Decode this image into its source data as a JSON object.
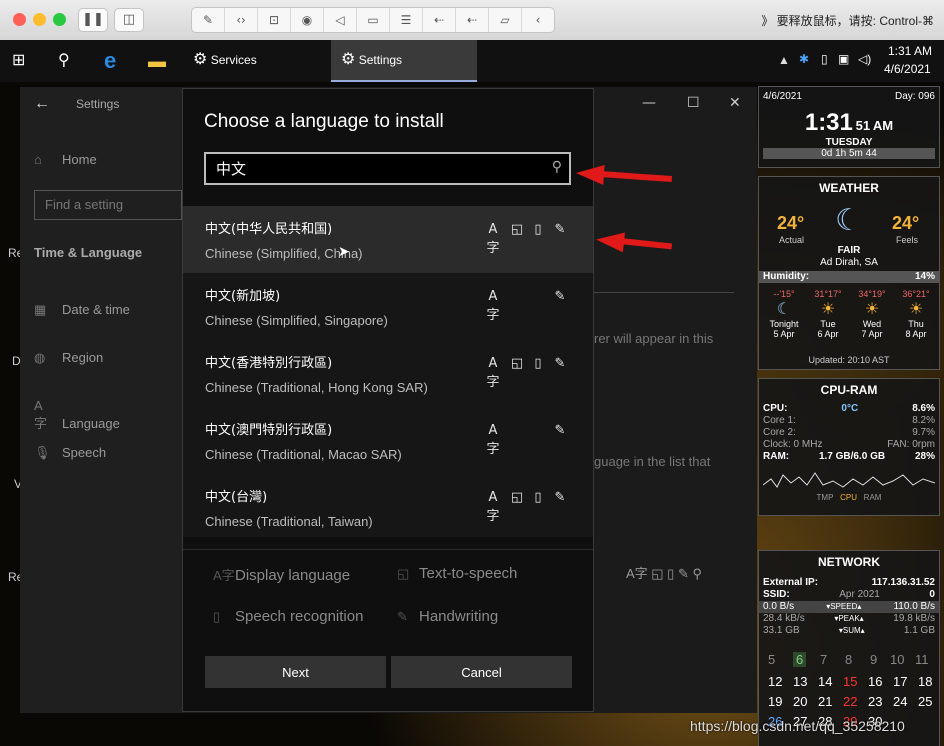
{
  "mac_toolbar": {
    "hint": "》 要释放鼠标，请按: Control-⌘"
  },
  "taskbar": {
    "tasks": [
      {
        "label": "Services"
      },
      {
        "label": "Settings"
      }
    ],
    "time": "1:31 AM",
    "date": "4/6/2021"
  },
  "settings_window": {
    "title": "Settings",
    "home": "Home",
    "find_placeholder": "Find a setting",
    "section": "Time & Language",
    "nav": [
      "Date & time",
      "Region",
      "Language",
      "Speech"
    ],
    "bg_text_1": "rer will appear in this",
    "bg_text_2": "guage in the list that"
  },
  "dialog": {
    "title": "Choose a language to install",
    "search_value": "中文",
    "languages": [
      {
        "native": "中文(中华人民共和国)",
        "english": "Chinese (Simplified, China)",
        "features": [
          "display",
          "tts",
          "speech",
          "handwriting"
        ]
      },
      {
        "native": "中文(新加坡)",
        "english": "Chinese (Simplified, Singapore)",
        "features": [
          "display",
          "handwriting"
        ]
      },
      {
        "native": "中文(香港特別行政區)",
        "english": "Chinese (Traditional, Hong Kong SAR)",
        "features": [
          "display",
          "tts",
          "speech",
          "handwriting"
        ]
      },
      {
        "native": "中文(澳門特別行政區)",
        "english": "Chinese (Traditional, Macao SAR)",
        "features": [
          "display",
          "handwriting"
        ]
      },
      {
        "native": "中文(台灣)",
        "english": "Chinese (Traditional, Taiwan)",
        "features": [
          "display",
          "tts",
          "speech",
          "handwriting"
        ]
      }
    ],
    "legend": {
      "display": "Display language",
      "tts": "Text-to-speech",
      "speech": "Speech recognition",
      "handwriting": "Handwriting"
    },
    "next": "Next",
    "cancel": "Cancel"
  },
  "clock_gadget": {
    "date": "4/6/2021",
    "day": "Day: 096",
    "time": "1:31",
    "seconds": "51",
    "ampm": "AM",
    "weekday": "TUESDAY",
    "elapsed": "0d 1h 5m 44"
  },
  "weather_gadget": {
    "title": "WEATHER",
    "actual": "24°",
    "actual_label": "Actual",
    "feels": "24°",
    "feels_label": "Feels",
    "condition": "FAIR",
    "location": "Ad Dirah, SA",
    "humidity_label": "Humidity:",
    "humidity": "14%",
    "forecast": [
      {
        "temps": "--'15°",
        "day": "Tonight",
        "date": "5 Apr"
      },
      {
        "temps": "31°17°",
        "day": "Tue",
        "date": "6 Apr"
      },
      {
        "temps": "34°19°",
        "day": "Wed",
        "date": "7 Apr"
      },
      {
        "temps": "36°21°",
        "day": "Thu",
        "date": "8 Apr"
      }
    ],
    "updated": "Updated: 20:10 AST"
  },
  "cpu_gadget": {
    "title": "CPU-RAM",
    "cpu_label": "CPU:",
    "cpu_temp": "0°C",
    "cpu_pct": "8.6%",
    "core1_label": "Core 1:",
    "core1": "8.2%",
    "core2_label": "Core 2:",
    "core2": "9.7%",
    "clock": "Clock: 0 MHz",
    "fan": "FAN: 0rpm",
    "ram_label": "RAM:",
    "ram": "1.7 GB/6.0 GB",
    "ram_pct": "28%",
    "graph_labels": [
      "TMP",
      "CPU",
      "RAM"
    ]
  },
  "network_gadget": {
    "title": "NETWORK",
    "ext_ip_label": "External IP:",
    "ext_ip": "117.136.31.52",
    "ssid_label": "SSID:",
    "ssid_date": "Apr 2021",
    "ssid": "0",
    "down": "0.0 B/s",
    "speed_label": "▾SPEED▴",
    "up": "110.0 B/s",
    "peak_down": "28.4 kB/s",
    "peak_label": "▾PEAK▴",
    "peak_up": "19.8 kB/s",
    "sum_down": "33.1 GB",
    "sum_label": "▾SUM▴",
    "sum_up": "1.1 GB"
  },
  "calendar": {
    "row1": [
      "5",
      "6",
      "7",
      "8",
      "9",
      "10",
      "11"
    ],
    "row2": [
      "12",
      "13",
      "14",
      "15",
      "16",
      "17",
      "18"
    ],
    "row3": [
      "19",
      "20",
      "21",
      "22",
      "23",
      "24",
      "25"
    ],
    "row4": [
      "26",
      "27",
      "28",
      "29",
      "30"
    ],
    "red_days": [
      "15",
      "22",
      "29"
    ],
    "highlight": "6"
  },
  "desktop_labels": [
    "Re",
    "D",
    "V",
    "Re"
  ],
  "watermark": "https://blog.csdn.net/qq_35258210"
}
